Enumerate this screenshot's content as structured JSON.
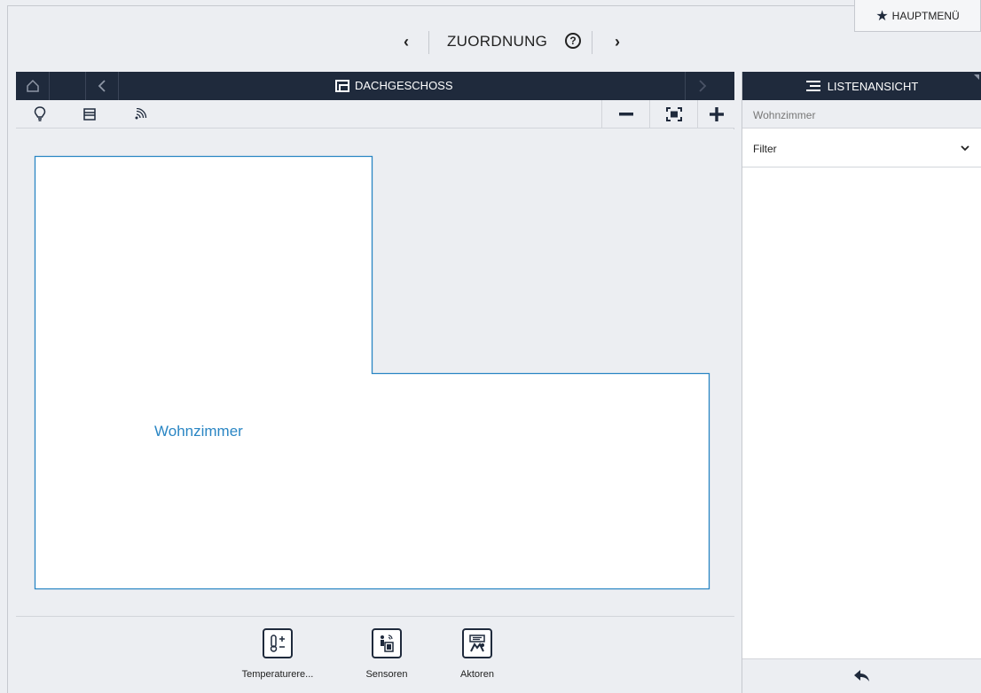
{
  "topbar": {
    "title": "ZUORDNUNG",
    "prev_label": "‹",
    "next_label": "›",
    "help_label": "?",
    "mainmenu_label": "HAUPTMENÜ"
  },
  "floorplan": {
    "floor_title": "DACHGESCHOSS",
    "room_name": "Wohnzimmer"
  },
  "categories": [
    {
      "label": "Temperaturere...",
      "icon": "thermostat-icon"
    },
    {
      "label": "Sensoren",
      "icon": "sensor-icon"
    },
    {
      "label": "Aktoren",
      "icon": "actuator-icon"
    }
  ],
  "listpanel": {
    "header_label": "LISTENANSICHT",
    "selected_room": "Wohnzimmer",
    "filter_label": "Filter"
  },
  "colors": {
    "header_bg": "#1f2a3c",
    "room_outline": "#2a86c4",
    "panel_bg": "#eceef2"
  }
}
